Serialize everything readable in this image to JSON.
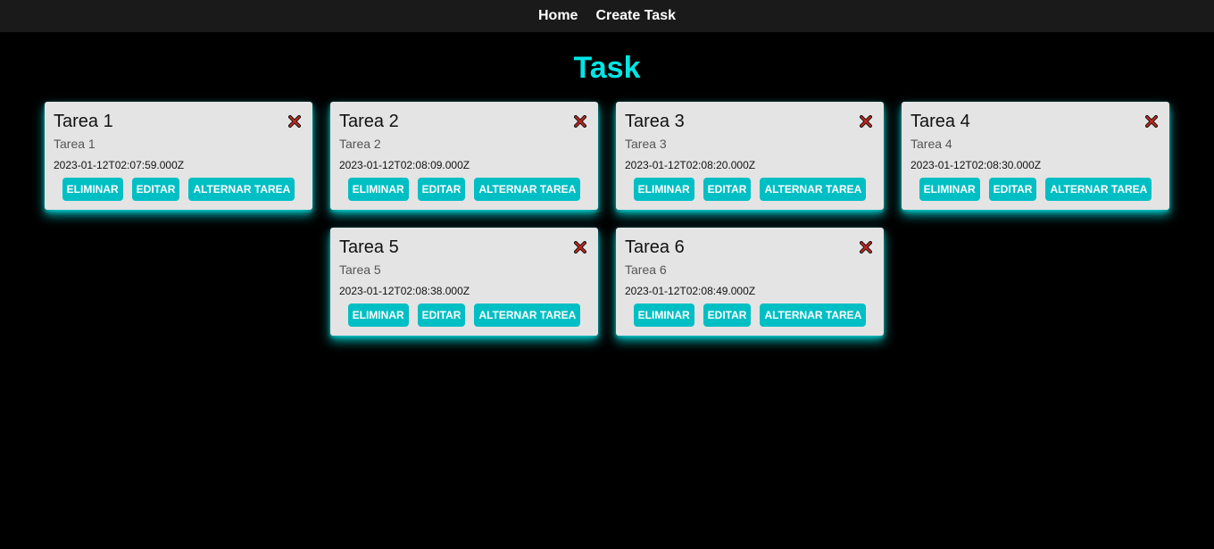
{
  "nav": {
    "home": "Home",
    "create": "Create Task"
  },
  "page": {
    "title": "Task"
  },
  "colors": {
    "accent": "#00e5e5",
    "button": "#00bfc4",
    "card": "#e4e4e4",
    "close": "#c0281e"
  },
  "actions": {
    "delete": "ELIMINAR",
    "edit": "EDITAR",
    "toggle": "ALTERNAR TAREA"
  },
  "tasks": [
    {
      "title": "Tarea 1",
      "description": "Tarea 1",
      "date": "2023-01-12T02:07:59.000Z"
    },
    {
      "title": "Tarea 2",
      "description": "Tarea 2",
      "date": "2023-01-12T02:08:09.000Z"
    },
    {
      "title": "Tarea 3",
      "description": "Tarea 3",
      "date": "2023-01-12T02:08:20.000Z"
    },
    {
      "title": "Tarea 4",
      "description": "Tarea 4",
      "date": "2023-01-12T02:08:30.000Z"
    },
    {
      "title": "Tarea 5",
      "description": "Tarea 5",
      "date": "2023-01-12T02:08:38.000Z"
    },
    {
      "title": "Tarea 6",
      "description": "Tarea 6",
      "date": "2023-01-12T02:08:49.000Z"
    }
  ]
}
